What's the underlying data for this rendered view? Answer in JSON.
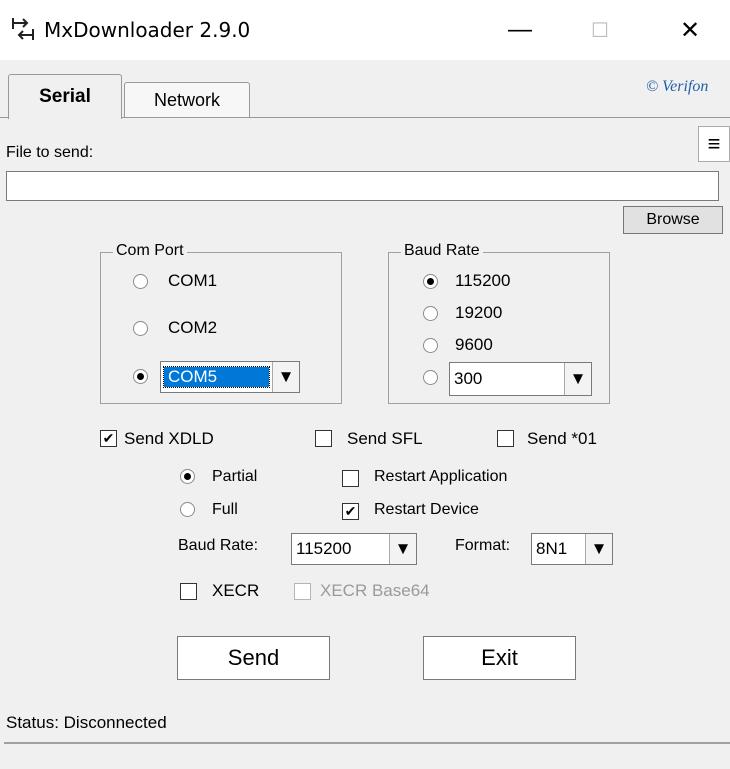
{
  "window": {
    "title": "MxDownloader 2.9.0",
    "minimize_glyph": "—",
    "maximize_glyph": "☐",
    "close_glyph": "✕"
  },
  "tabs": {
    "serial": "Serial",
    "network": "Network"
  },
  "copyright": "© Verifon",
  "menu_icon": "≡",
  "file": {
    "label": "File to send:",
    "value": "",
    "browse": "Browse"
  },
  "com_port": {
    "title": "Com Port",
    "options": [
      "COM1",
      "COM2"
    ],
    "selected": "COM5",
    "arrow": "▼"
  },
  "baud_rate_group": {
    "title": "Baud Rate",
    "options": [
      "115200",
      "19200",
      "9600"
    ],
    "custom_value": "300",
    "arrow": "▼"
  },
  "send_options": {
    "send_xdld": "Send XDLD",
    "send_sfl": "Send SFL",
    "send_01": "Send *01",
    "partial": "Partial",
    "full": "Full",
    "restart_app": "Restart Application",
    "restart_device": "Restart Device",
    "baud_label": "Baud Rate:",
    "baud_value": "115200",
    "format_label": "Format:",
    "format_value": "8N1",
    "xecr": "XECR",
    "xecr_base64": "XECR Base64",
    "check_glyph": "✔"
  },
  "buttons": {
    "send": "Send",
    "exit": "Exit"
  },
  "status": "Status: Disconnected"
}
